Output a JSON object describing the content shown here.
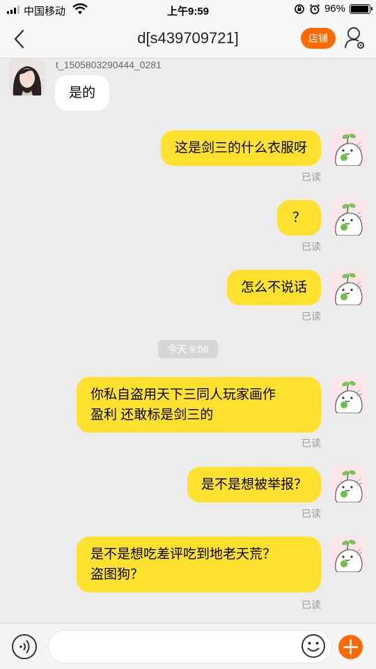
{
  "status": {
    "carrier": "中国移动",
    "time": "上午9:59",
    "battery_text": "96%",
    "battery_level": 0.96
  },
  "nav": {
    "title": "d[s439709721]",
    "shop_label": "店铺"
  },
  "chat": {
    "sender_name": "t_1505803290444_0281",
    "incoming": [
      {
        "text": "是的"
      }
    ],
    "outgoing": [
      {
        "text": "这是剑三的什么衣服呀",
        "status": "已读"
      },
      {
        "text": "？",
        "status": "已读"
      },
      {
        "text": "怎么不说话",
        "status": "已读"
      },
      {
        "line1": "你私自盗用天下三同人玩家画作",
        "line2": "盈利 还敢标是剑三的",
        "status": "已读"
      },
      {
        "text": "是不是想被举报？",
        "status": "已读"
      },
      {
        "line1": "是不是想吃差评吃到地老天荒？",
        "line2": "盗图狗？",
        "status": "已读"
      }
    ],
    "time_divider": "今天 9:56"
  },
  "input": {
    "placeholder": ""
  },
  "colors": {
    "accent": "#ff6a00",
    "bubble_out": "#ffe12e",
    "bubble_in": "#ffffff",
    "background": "#ececec"
  },
  "icons": [
    "signal-icon",
    "wifi-icon",
    "lock-rotation-icon",
    "alarm-icon",
    "battery-icon",
    "back-arrow-icon",
    "profile-settings-icon",
    "voice-icon",
    "emoji-icon",
    "plus-icon"
  ]
}
